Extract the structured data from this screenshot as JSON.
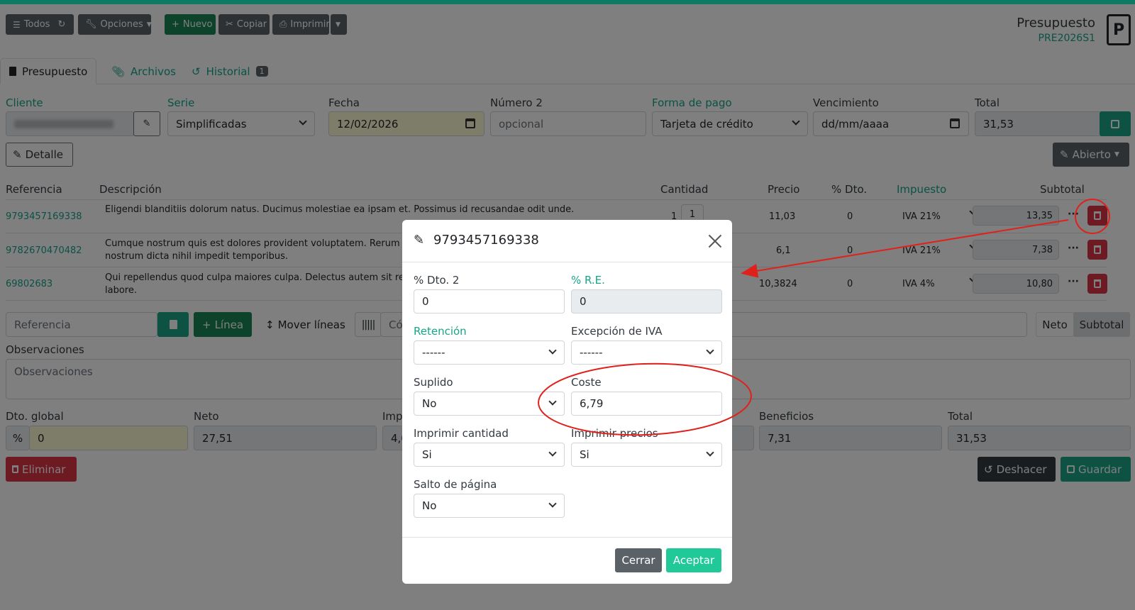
{
  "toolbar": {
    "todos": "Todos",
    "opciones": "Opciones",
    "nuevo": "Nuevo",
    "copiar": "Copiar",
    "imprimir": "Imprimir"
  },
  "doc": {
    "title": "Presupuesto",
    "code": "PRE2026S1"
  },
  "tabs": [
    {
      "label": "Presupuesto"
    },
    {
      "label": "Archivos"
    },
    {
      "label": "Historial",
      "badge": "1"
    }
  ],
  "form": {
    "cliente_label": "Cliente",
    "serie_label": "Serie",
    "serie_value": "Simplificadas",
    "fecha_label": "Fecha",
    "fecha_value": "12/02/2026",
    "numero2_label": "Número 2",
    "numero2_placeholder": "opcional",
    "forma_pago_label": "Forma de pago",
    "forma_pago_value": "Tarjeta de crédito",
    "vencimiento_label": "Vencimiento",
    "vencimiento_placeholder": "dd/mm/aaaa",
    "total_label": "Total",
    "total_value": "31,53",
    "detalle_button": "Detalle",
    "abierto_button": "Abierto"
  },
  "lines": {
    "headers": {
      "referencia": "Referencia",
      "descripcion": "Descripción",
      "cantidad": "Cantidad",
      "precio": "Precio",
      "dto": "% Dto.",
      "impuesto": "Impuesto",
      "subtotal": "Subtotal"
    },
    "rows": [
      {
        "ref": "9793457169338",
        "desc": "Eligendi blanditiis dolorum natus. Ducimus molestiae ea ipsam et. Possimus id recusandae odit unde.",
        "desc2": "",
        "qty": "1",
        "price": "11,03",
        "dto": "0",
        "tax": "IVA 21%",
        "subtotal": "13,35"
      },
      {
        "ref": "9782670470482",
        "desc": "Cumque nostrum quis est dolores provident voluptatem. Rerum praese",
        "desc2": "nostrum dicta nihil impedit temporibus.",
        "qty": "",
        "price": "6,1",
        "dto": "0",
        "tax": "IVA 21%",
        "subtotal": "7,38"
      },
      {
        "ref": "69802683",
        "desc": "Qui repellendus quod culpa maiores culpa. Delectus autem sit repellat a",
        "desc2": "labore.",
        "qty": "",
        "price": "10,3824",
        "dto": "0",
        "tax": "IVA 4%",
        "subtotal": "10,80"
      }
    ]
  },
  "linebar": {
    "referencia_placeholder": "Referencia",
    "linea_button": "Línea",
    "mover_button": "Mover líneas",
    "codigo_placeholder": "Có",
    "neto_tab": "Neto",
    "subtotal_tab": "Subtotal"
  },
  "observaciones": {
    "label": "Observaciones",
    "placeholder": "Observaciones"
  },
  "totals": {
    "dto_global_label": "Dto. global",
    "dto_global_value": "0",
    "neto_label": "Neto",
    "neto_value": "27,51",
    "impuestos_label": "Impu",
    "impuestos_value": "4,0",
    "beneficios_label": "Beneficios",
    "beneficios_value": "7,31",
    "total_label": "Total",
    "total_value": "31,53"
  },
  "actions": {
    "eliminar": "Eliminar",
    "deshacer": "Deshacer",
    "guardar": "Guardar"
  },
  "modal": {
    "title": "9793457169338",
    "dto2_label": "% Dto. 2",
    "dto2_value": "0",
    "re_label": "% R.E.",
    "re_value": "0",
    "retencion_label": "Retención",
    "retencion_value": "------",
    "excepcion_label": "Excepción de IVA",
    "excepcion_value": "------",
    "suplido_label": "Suplido",
    "suplido_value": "No",
    "coste_label": "Coste",
    "coste_value": "6,79",
    "imp_cantidad_label": "Imprimir cantidad",
    "imp_cantidad_value": "Si",
    "imp_precios_label": "Imprimir precios",
    "imp_precios_value": "Si",
    "salto_label": "Salto de página",
    "salto_value": "No",
    "cerrar": "Cerrar",
    "aceptar": "Aceptar"
  },
  "colors": {
    "brand": "#0d7a63",
    "teal": "#1aa584",
    "danger": "#dc3545",
    "annotation": "#e0211b"
  }
}
